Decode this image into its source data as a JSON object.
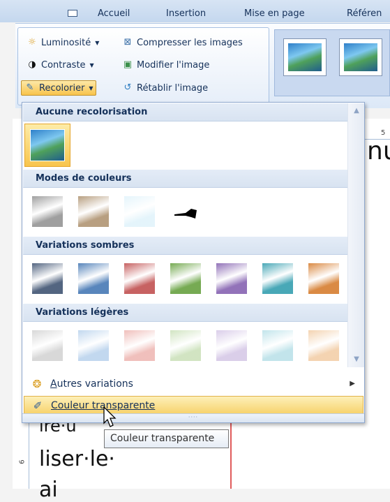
{
  "tabs": {
    "accueil": "Accueil",
    "insertion": "Insertion",
    "mise_en_page": "Mise en page",
    "references": "Référen"
  },
  "ribbon": {
    "luminosite": "Luminosité",
    "contraste": "Contraste",
    "recolorier": "Recolorier",
    "compresser": "Compresser les images",
    "modifier": "Modifier l'image",
    "retablir": "Rétablir l'image"
  },
  "dropdown": {
    "sections": {
      "aucune": "Aucune recolorisation",
      "modes": "Modes de couleurs",
      "sombres": "Variations sombres",
      "legeres": "Variations légères"
    },
    "autres_variations_key": "A",
    "autres_variations_rest": "utres variations",
    "couleur_transparente_key": "C",
    "couleur_transparente_rest": "ouleur transparente",
    "grip": "····"
  },
  "tooltip": "Couleur transparente",
  "document": {
    "ruler_top_number": "5",
    "ruler_left_number": "6",
    "text_line_1": "liser·le·",
    "text_right_fragment": "nu",
    "text_behind_menu": "ire·u",
    "text_bottom": "ai"
  },
  "colors": {
    "accent_orange": "#f8c54d",
    "header_blue": "#15315a",
    "dark_variations": [
      "#4a5d7a",
      "#4f7fb8",
      "#c45a5a",
      "#6fa64a",
      "#8c6bb5",
      "#3fa3b3",
      "#d8843a"
    ],
    "light_variations": [
      "#d6d6d6",
      "#bfd6ee",
      "#efbcb8",
      "#cfe3bf",
      "#d8cbe8",
      "#bfe3ea",
      "#f3d1ad"
    ],
    "mode_variations": [
      "#9a9a9a",
      "#b49a7a",
      "#e3f4fb",
      "#000000"
    ]
  },
  "icons": {
    "luminosite": "sun-icon",
    "contraste": "contrast-icon",
    "recolorier": "recolor-icon",
    "compresser": "compress-icon",
    "modifier": "change-picture-icon",
    "retablir": "reset-picture-icon",
    "autres": "palette-icon",
    "transparente": "pen-icon"
  }
}
